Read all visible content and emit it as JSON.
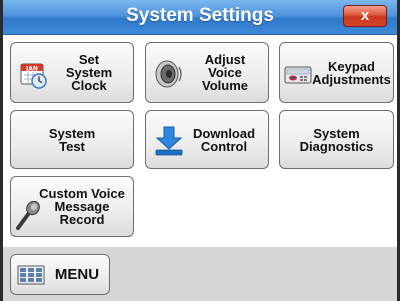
{
  "window": {
    "title": "System Settings",
    "close_label": "x"
  },
  "buttons": {
    "set_clock": {
      "lines": [
        "Set",
        "System",
        "Clock"
      ]
    },
    "adjust_volume": {
      "lines": [
        "Adjust",
        "Voice",
        "Volume"
      ]
    },
    "keypad": {
      "lines": [
        "Keypad",
        "Adjustments"
      ]
    },
    "system_test": {
      "lines": [
        "System",
        "Test"
      ]
    },
    "download": {
      "lines": [
        "Download",
        "Control"
      ]
    },
    "diagnostics": {
      "lines": [
        "System",
        "Diagnostics"
      ]
    },
    "custom_voice": {
      "lines": [
        "Custom Voice",
        "Message",
        "Record"
      ]
    }
  },
  "calendar_icon_text": "JAN",
  "menu": {
    "label": "MENU"
  },
  "colors": {
    "titlebar": "#4f95de",
    "close": "#d9452a",
    "button_face": "#ececec",
    "bottom_bar": "#d6d6d6",
    "download_arrow": "#1e6fc8"
  }
}
